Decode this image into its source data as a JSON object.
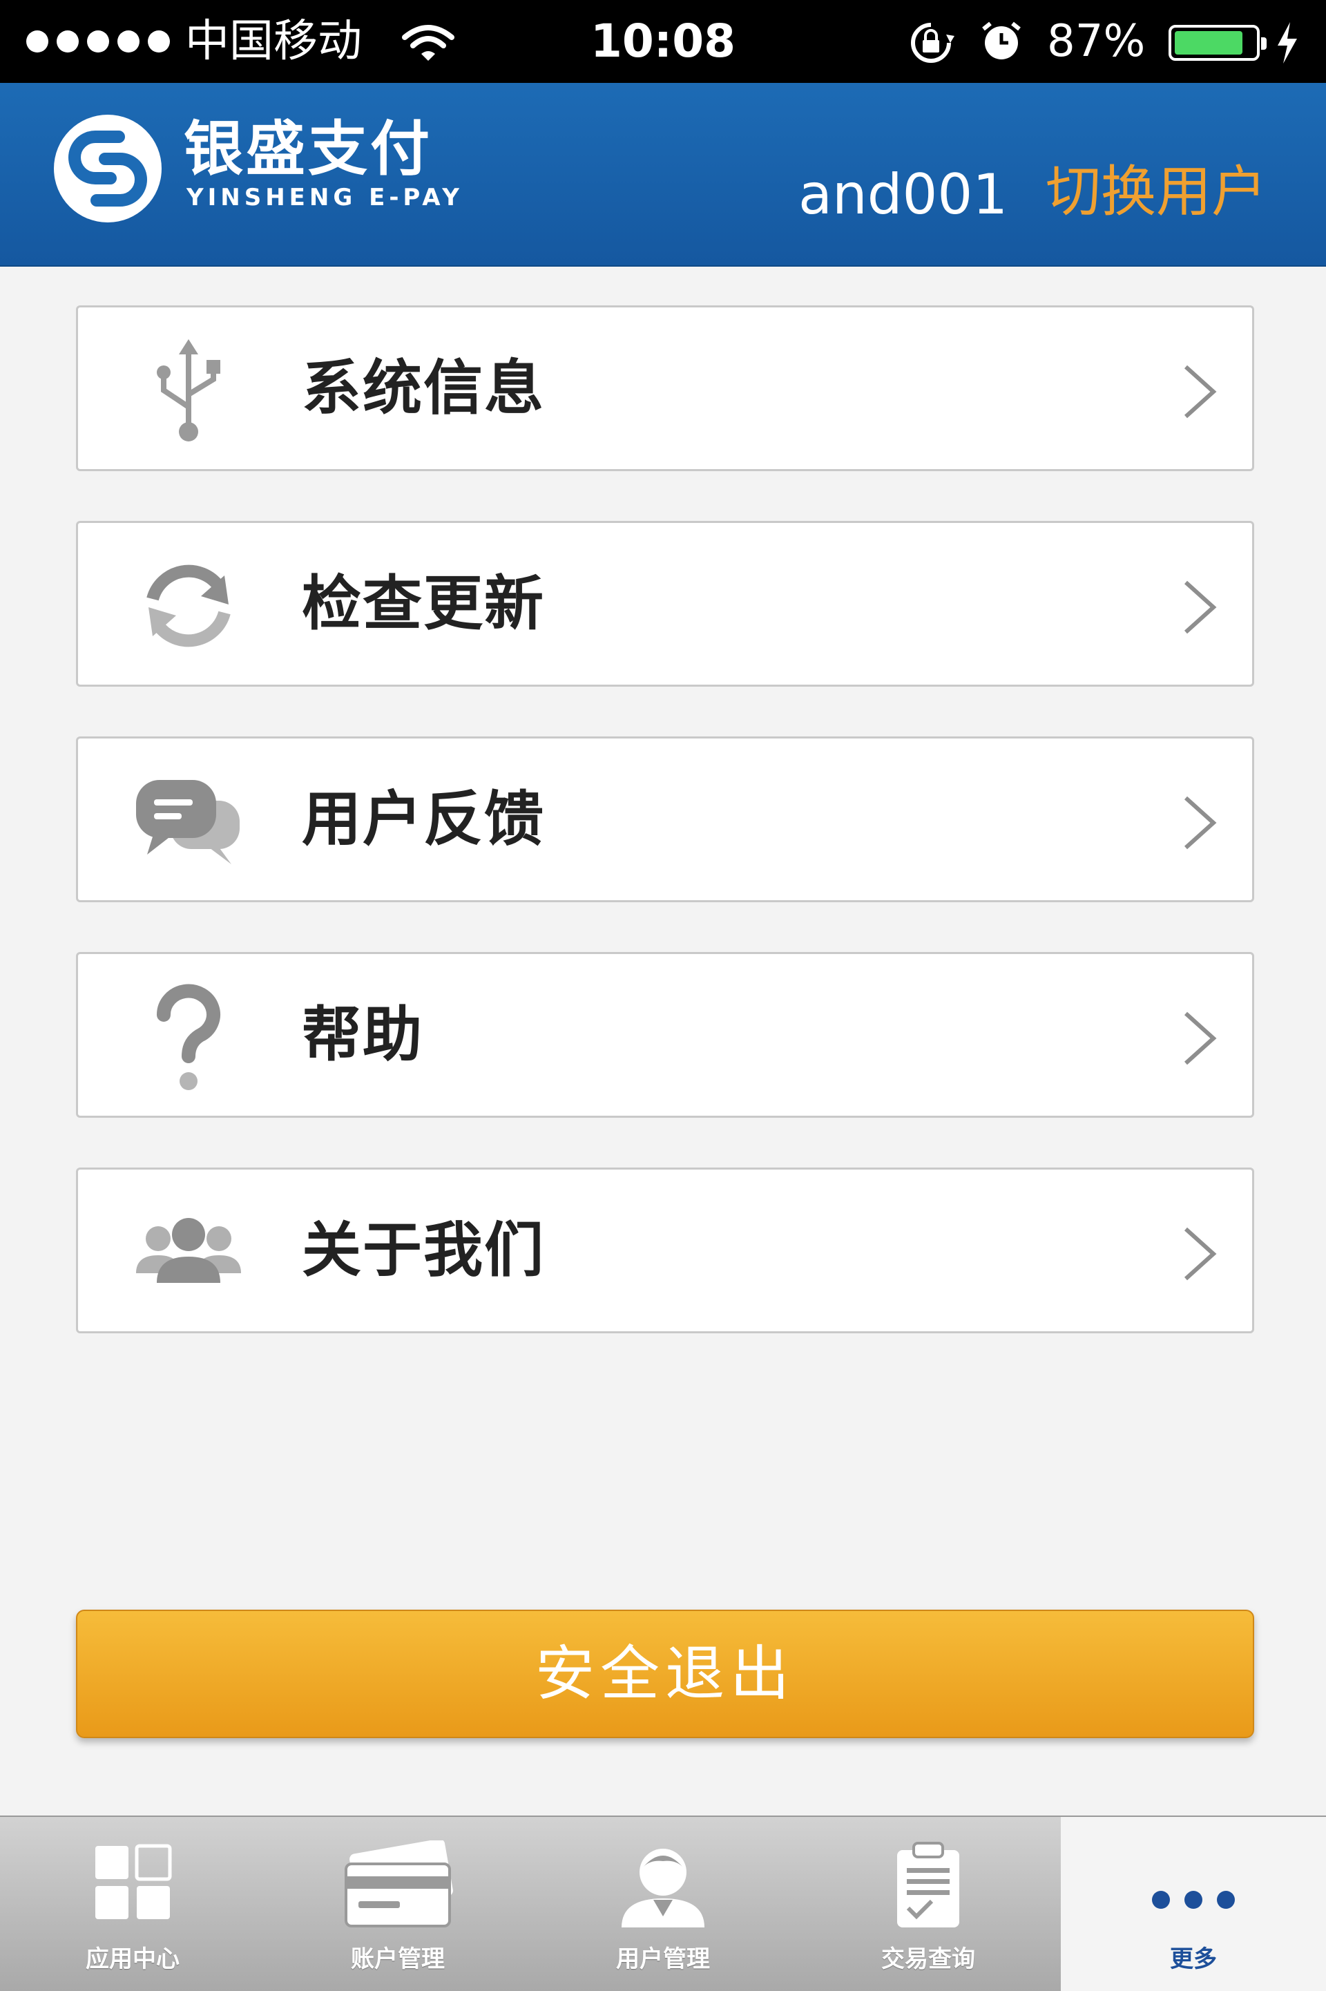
{
  "status_bar": {
    "carrier": "中国移动",
    "time": "10:08",
    "battery_percent": "87%",
    "battery_level": 0.87,
    "icons": [
      "signal-dots-icon",
      "wifi-icon",
      "rotation-lock-icon",
      "alarm-icon",
      "battery-icon",
      "charging-icon"
    ]
  },
  "header": {
    "logo_cn": "银盛支付",
    "logo_en": "YINSHENG E-PAY",
    "username": "and001",
    "switch_user": "切换用户",
    "background_color": "#1d6bb5",
    "accent_color": "#f0a030"
  },
  "menu": {
    "items": [
      {
        "label": "系统信息",
        "icon": "usb-icon"
      },
      {
        "label": "检查更新",
        "icon": "refresh-icon"
      },
      {
        "label": "用户反馈",
        "icon": "chat-bubbles-icon"
      },
      {
        "label": "帮助",
        "icon": "question-icon"
      },
      {
        "label": "关于我们",
        "icon": "group-users-icon"
      }
    ]
  },
  "logout": {
    "label": "安全退出",
    "color": "#f0a623"
  },
  "tabbar": {
    "active_index": 4,
    "tabs": [
      {
        "label": "应用中心",
        "icon": "app-grid-icon"
      },
      {
        "label": "账户管理",
        "icon": "bank-card-icon"
      },
      {
        "label": "用户管理",
        "icon": "user-profile-icon"
      },
      {
        "label": "交易查询",
        "icon": "clipboard-icon"
      },
      {
        "label": "更多",
        "icon": "more-dots-icon"
      }
    ]
  }
}
